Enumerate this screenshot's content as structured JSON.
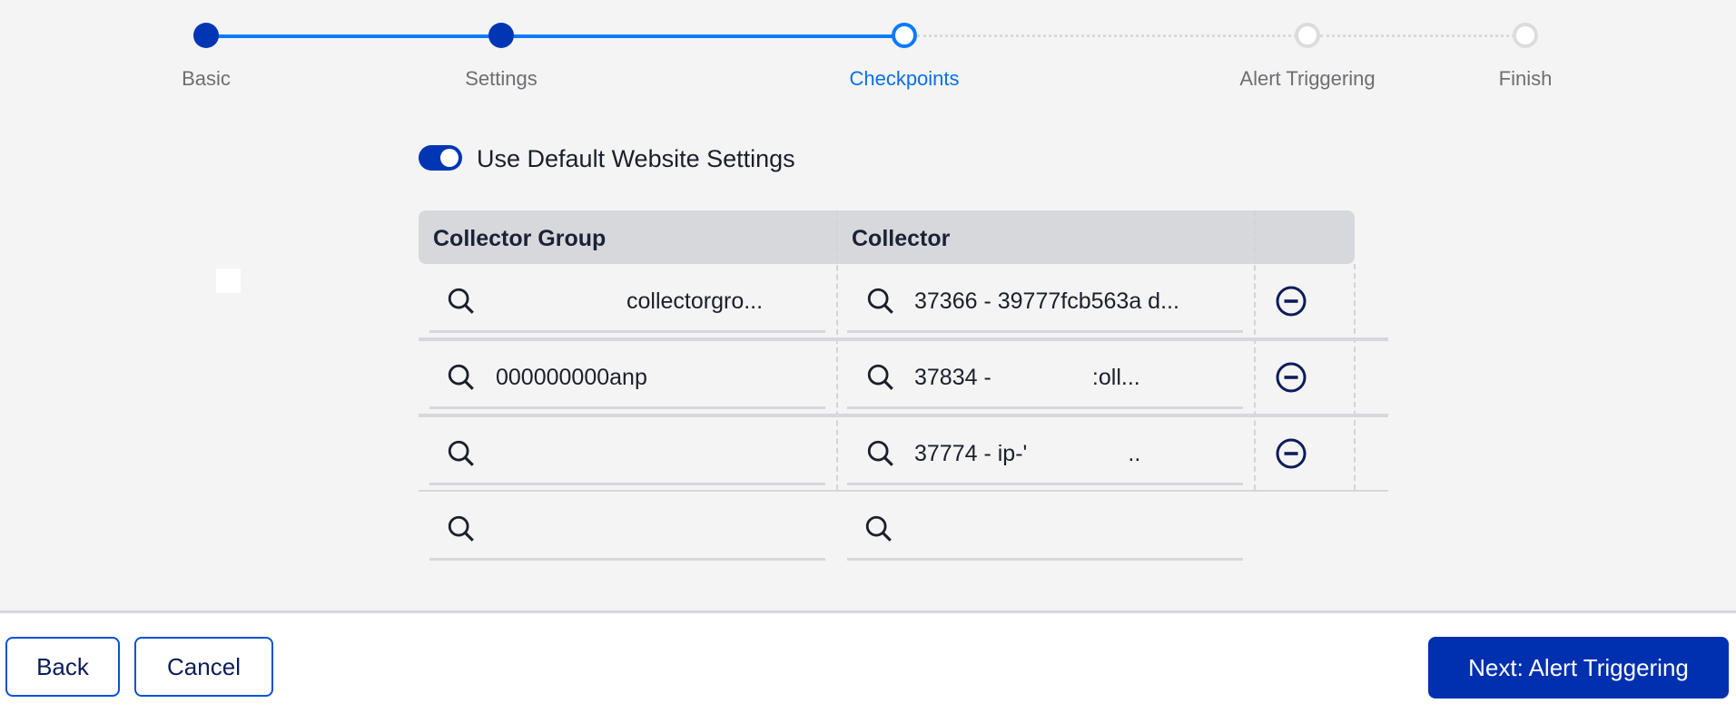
{
  "stepper": {
    "steps": [
      {
        "label": "Basic",
        "state": "done"
      },
      {
        "label": "Settings",
        "state": "done"
      },
      {
        "label": "Checkpoints",
        "state": "current"
      },
      {
        "label": "Alert Triggering",
        "state": "todo"
      },
      {
        "label": "Finish",
        "state": "todo"
      }
    ]
  },
  "settings": {
    "use_default_label": "Use Default Website Settings",
    "use_default_on": true
  },
  "table": {
    "headers": {
      "collector_group": "Collector Group",
      "collector": "Collector"
    },
    "rows": [
      {
        "collector_group": "collectorgro...",
        "collector": "37366 - 39777fcb563a d...",
        "removable": true
      },
      {
        "collector_group": "000000000anp",
        "collector": "37834 -                :oll...",
        "removable": true
      },
      {
        "collector_group": "",
        "collector": "37774 - ip-'                ..",
        "removable": true
      },
      {
        "collector_group": "",
        "collector": "",
        "removable": false
      }
    ]
  },
  "icons": {
    "search": "search-icon",
    "remove": "minus-circle-icon"
  },
  "footer": {
    "back_label": "Back",
    "cancel_label": "Cancel",
    "next_label": "Next: Alert Triggering"
  },
  "colors": {
    "primary": "#0030b0",
    "progress": "#0a7aff",
    "step_done": "#0036b3",
    "step_current_label": "#0a6fe8",
    "step_todo": "#dcdcdc"
  }
}
